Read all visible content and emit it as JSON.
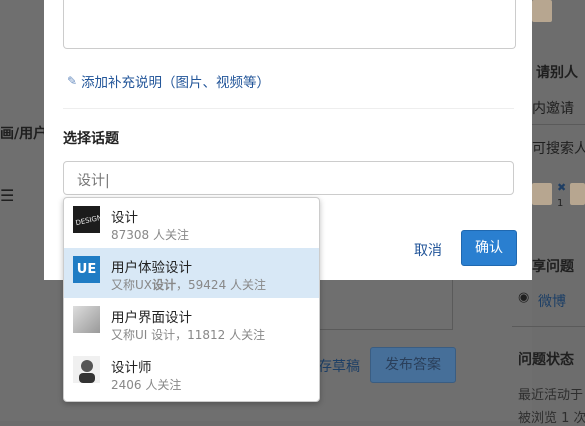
{
  "background": {
    "left_text": "画/用户",
    "invite_title": "请别人",
    "invite_tab": "内邀请",
    "search_people": "可搜索人",
    "share_title": "享问题",
    "weibo": "微博",
    "question_status": "问题状态",
    "recent_activity": "最近活动于",
    "viewed": "被浏览 1 次",
    "counter": "1",
    "save_draft": "存草稿",
    "publish_answer": "发布答案"
  },
  "modal": {
    "add_note": "添加补充说明（图片、视频等）",
    "select_topic_title": "选择话题",
    "topic_input_value": "设计|",
    "cancel_label": "取消",
    "confirm_label": "确认"
  },
  "suggestions": [
    {
      "name": "设计",
      "sub_prefix": "",
      "sub_bold": "",
      "sub_rest": "87308 人关注",
      "thumb": "design-thumb",
      "selected": false
    },
    {
      "name": "用户体验设计",
      "sub_prefix": "又称UX",
      "sub_bold": "设计",
      "sub_rest": "，59424 人关注",
      "thumb": "ue-logo",
      "selected": true
    },
    {
      "name": "用户界面设计",
      "sub_prefix": "又称UI 设计，",
      "sub_bold": "",
      "sub_rest": "11812 人关注",
      "thumb": "ui-thumb",
      "selected": false
    },
    {
      "name": "设计师",
      "sub_prefix": "",
      "sub_bold": "",
      "sub_rest": "2406 人关注",
      "thumb": "person-thumb",
      "selected": false
    }
  ],
  "colors": {
    "accent": "#2a7fd0",
    "link": "#225599",
    "selected_row": "#d8e8f6"
  }
}
